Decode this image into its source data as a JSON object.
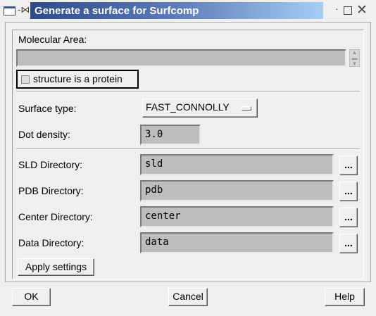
{
  "window": {
    "title": "Generate a surface for Surfcomp"
  },
  "molecular_area": {
    "label": "Molecular Area:",
    "value": ""
  },
  "protein_checkbox": {
    "label": "structure is a protein",
    "checked": false
  },
  "surface_type": {
    "label": "Surface type:",
    "value": "FAST_CONNOLLY"
  },
  "dot_density": {
    "label": "Dot density:",
    "value": "3.0"
  },
  "directories": [
    {
      "label": "SLD Directory:",
      "value": "sld",
      "browse": "..."
    },
    {
      "label": "PDB Directory:",
      "value": "pdb",
      "browse": "..."
    },
    {
      "label": "Center Directory:",
      "value": "center",
      "browse": "..."
    },
    {
      "label": "Data Directory:",
      "value": "data",
      "browse": "..."
    }
  ],
  "buttons": {
    "apply": "Apply settings",
    "ok": "OK",
    "cancel": "Cancel",
    "help": "Help"
  }
}
